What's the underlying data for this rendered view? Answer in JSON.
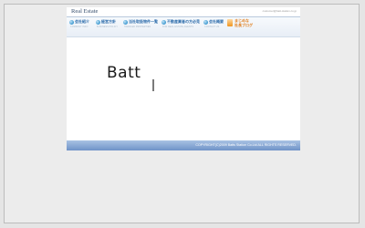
{
  "header": {
    "title": "Real Estate",
    "email": "customer@batt-station.co.jp"
  },
  "nav": {
    "items": [
      {
        "label": "会社紹介",
        "sub": "COMPANY INFO"
      },
      {
        "label": "経営方針",
        "sub": "BUSINESS POLICY"
      },
      {
        "label": "当社取扱物件一覧",
        "sub": "HANDLED PROPERTIES"
      },
      {
        "label": "不動産業者の方必見",
        "sub": "FOR REAL ESTATE AGENTS"
      },
      {
        "label": "会社概要",
        "sub": "CONTACT US"
      }
    ],
    "blog": {
      "line1": "まじめな",
      "line2": "社長ブログ"
    }
  },
  "content": {
    "logo_text": "Batt"
  },
  "footer": {
    "copyright": "COPYRIGHT(C)2009 Batts Station Co.Ltd ALL RIGHTS RESERVED."
  }
}
